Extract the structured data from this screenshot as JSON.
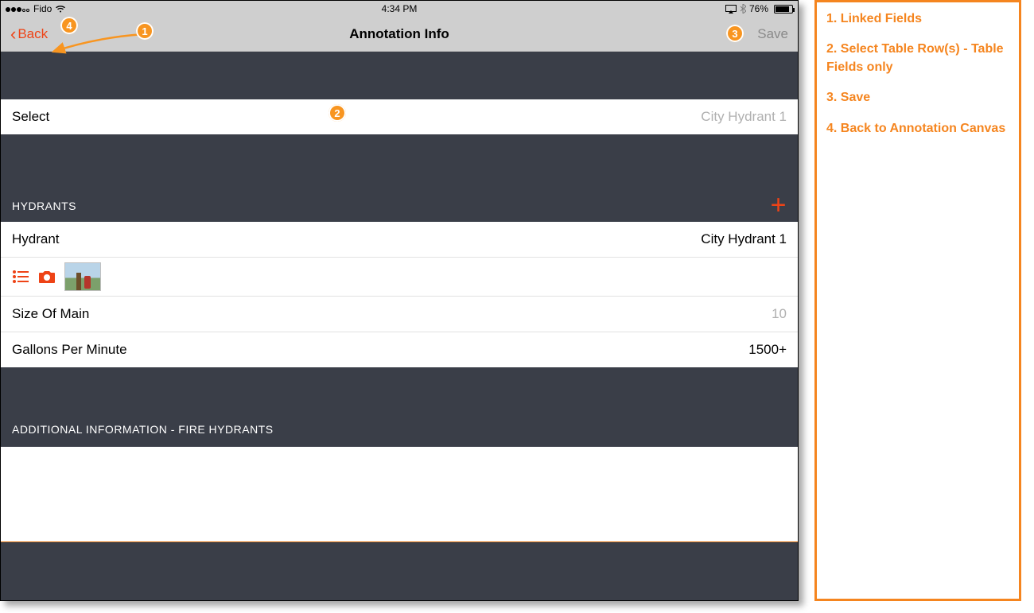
{
  "status": {
    "carrier": "Fido",
    "time": "4:34 PM",
    "battery_pct": "76%"
  },
  "nav": {
    "back_label": "Back",
    "title": "Annotation Info",
    "save_label": "Save"
  },
  "select_row": {
    "label": "Select",
    "value": "City Hydrant 1"
  },
  "sections": {
    "hydrants_header": "HYDRANTS",
    "additional_header": "ADDITIONAL INFORMATION - FIRE HYDRANTS"
  },
  "fields": {
    "hydrant": {
      "label": "Hydrant",
      "value": "City Hydrant 1"
    },
    "size_of_main": {
      "label": "Size Of Main",
      "value": "10"
    },
    "gpm": {
      "label": "Gallons Per Minute",
      "value": "1500+"
    }
  },
  "markers": {
    "m1": "1",
    "m2": "2",
    "m3": "3",
    "m4": "4"
  },
  "legend": {
    "i1": "1. Linked Fields",
    "i2": "2. Select Table Row(s) - Table Fields only",
    "i3": "3. Save",
    "i4": "4. Back to Annotation Canvas"
  },
  "icons": {
    "plus": "+",
    "chevron_left": "‹"
  }
}
